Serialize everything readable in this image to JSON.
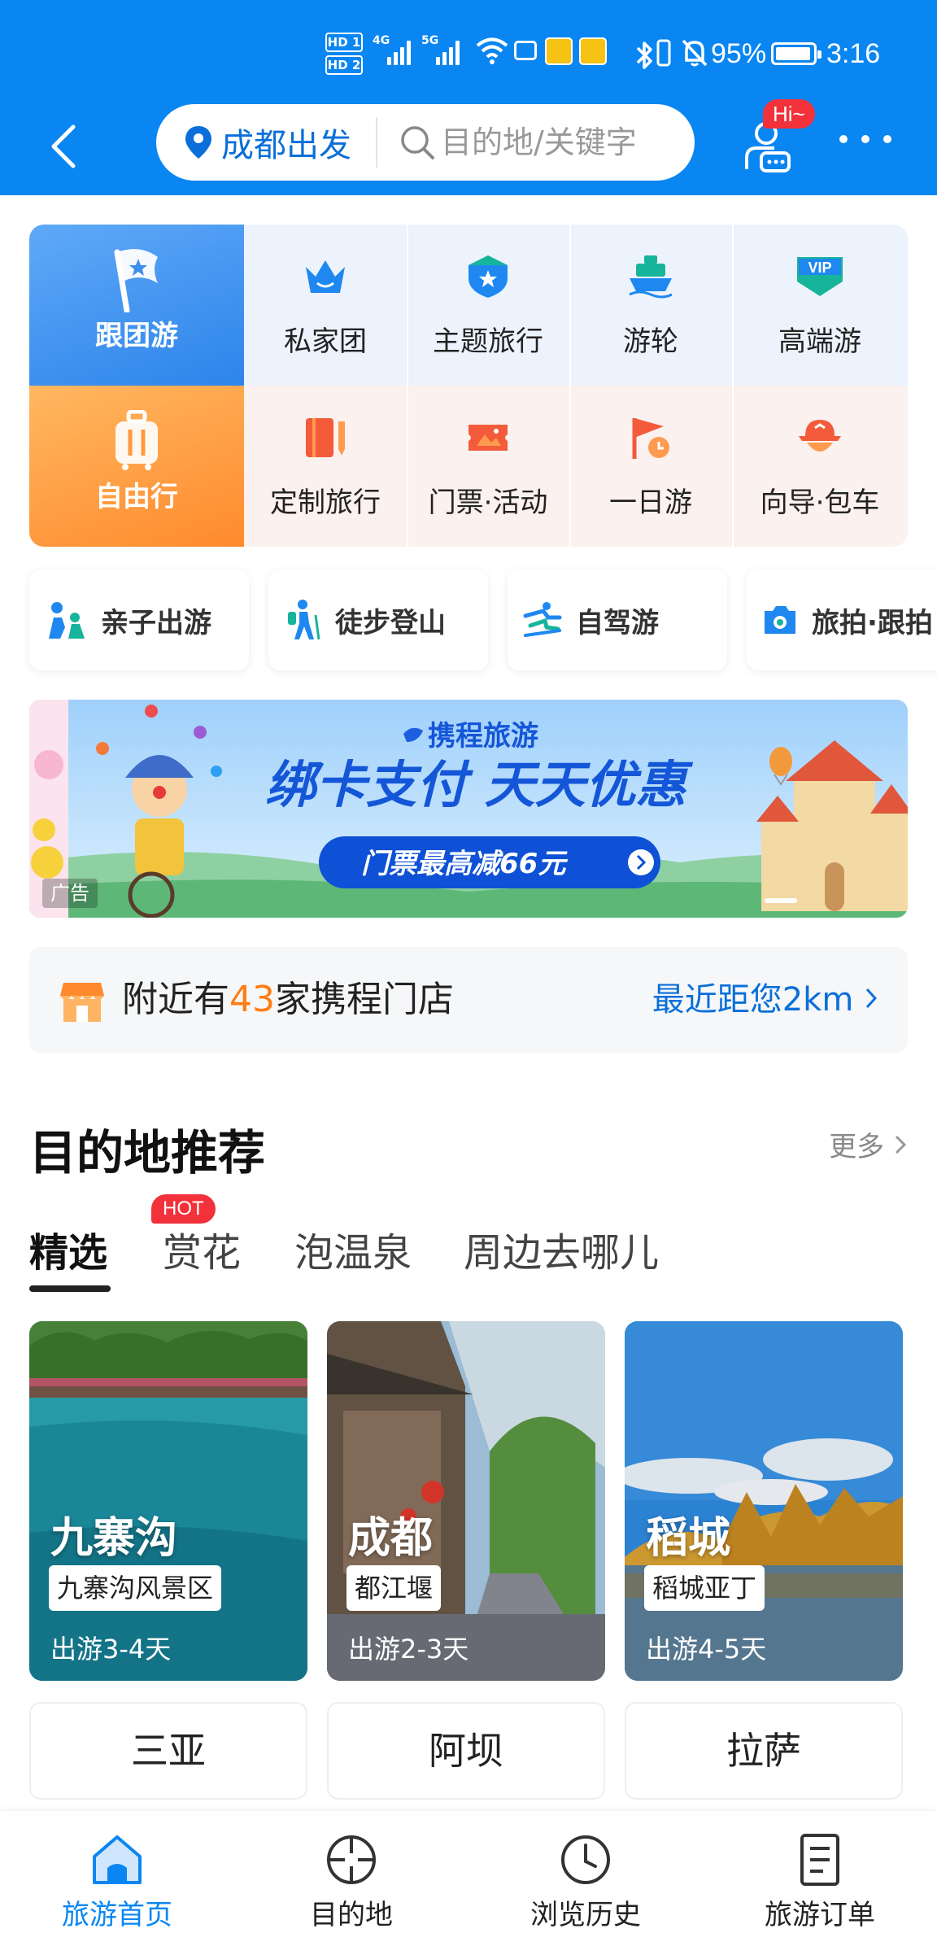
{
  "status_bar": {
    "hd1": "HD 1",
    "hd2": "HD 2",
    "net1": "4G",
    "net2": "5G",
    "wifi_sup": "6",
    "battery": "95%",
    "time": "3:16"
  },
  "header": {
    "departure_city": "成都出发",
    "search_placeholder": "目的地/关键字",
    "hi_badge": "Hi~"
  },
  "grid": {
    "row1": [
      {
        "label": "跟团游",
        "icon": "flag-star-icon"
      },
      {
        "label": "私家团",
        "icon": "crown-icon"
      },
      {
        "label": "主题旅行",
        "icon": "shield-star-icon"
      },
      {
        "label": "游轮",
        "icon": "cruise-ship-icon"
      },
      {
        "label": "高端游",
        "icon": "vip-icon"
      }
    ],
    "row2": [
      {
        "label": "自由行",
        "icon": "luggage-icon"
      },
      {
        "label": "定制旅行",
        "icon": "notebook-pen-icon"
      },
      {
        "label": "门票·活动",
        "icon": "ticket-icon"
      },
      {
        "label": "一日游",
        "icon": "flag-clock-icon"
      },
      {
        "label": "向导·包车",
        "icon": "guide-hat-icon"
      }
    ]
  },
  "chips": [
    {
      "label": "亲子出游",
      "icon": "family-icon"
    },
    {
      "label": "徒步登山",
      "icon": "hiking-icon"
    },
    {
      "label": "自驾游",
      "icon": "self-drive-icon"
    },
    {
      "label": "旅拍·跟拍",
      "icon": "camera-icon"
    }
  ],
  "banner": {
    "brand": "携程旅游",
    "headline": "绑卡支付 天天优惠",
    "offer": "门票最高减66元",
    "ad_tag": "广告"
  },
  "store": {
    "prefix": "附近有",
    "count": "43",
    "suffix": "家携程门店",
    "distance": "最近距您2km"
  },
  "section": {
    "title": "目的地推荐",
    "more": "更多",
    "tabs": [
      "精选",
      "赏花",
      "泡温泉",
      "周边去哪儿"
    ],
    "hot_badge": "HOT"
  },
  "cards": [
    {
      "city": "九寨沟",
      "spot": "九寨沟风景区",
      "duration": "出游3-4天"
    },
    {
      "city": "成都",
      "spot": "都江堰",
      "duration": "出游2-3天"
    },
    {
      "city": "稻城",
      "spot": "稻城亚丁",
      "duration": "出游4-5天"
    }
  ],
  "destinations": [
    "三亚",
    "阿坝",
    "拉萨"
  ],
  "bottom_nav": [
    {
      "label": "旅游首页",
      "icon": "home-icon"
    },
    {
      "label": "目的地",
      "icon": "crosshair-icon"
    },
    {
      "label": "浏览历史",
      "icon": "clock-icon"
    },
    {
      "label": "旅游订单",
      "icon": "order-list-icon"
    }
  ],
  "colors": {
    "brand_blue": "#0A86F2",
    "accent_orange": "#FF7D13",
    "hot_red": "#F2313A"
  }
}
